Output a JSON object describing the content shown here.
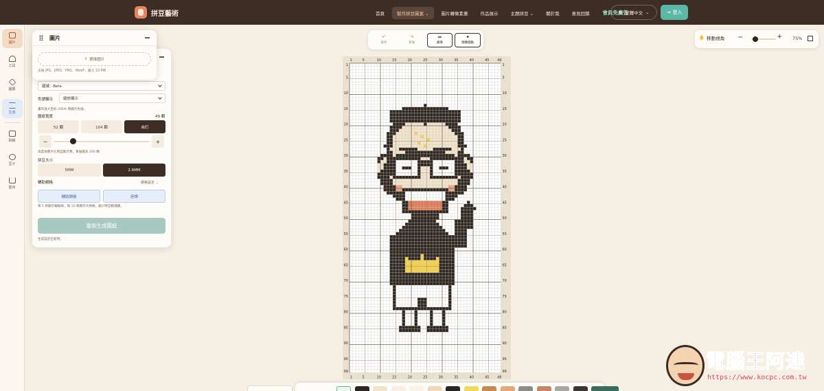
{
  "brand": {
    "name": "拼豆藝術"
  },
  "nav": {
    "items": [
      "首頁",
      "製作拼豆圖案",
      "圖片轉像素畫",
      "作品展示",
      "主題拼豆",
      "關於我",
      "意見回饋"
    ],
    "active_index": 1,
    "vip": "會員免廣告",
    "language": "繁體中文",
    "login": "登入"
  },
  "rail": {
    "items": [
      {
        "label": "圖片",
        "icon": "image-icon"
      },
      {
        "label": "工具",
        "icon": "brush-icon"
      },
      {
        "label": "圖層",
        "icon": "layers-icon"
      },
      {
        "label": "生成",
        "icon": "sliders-icon"
      },
      {
        "label": "對稱",
        "icon": "mirror-icon"
      },
      {
        "label": "豆子",
        "icon": "palette-icon"
      },
      {
        "label": "匯出",
        "icon": "download-icon"
      }
    ]
  },
  "image_panel": {
    "title": "圖片",
    "upload_label": "更換圖片",
    "upload_hint": "支援 JPG、JPEG、PNG、WebP，最大 10 MB"
  },
  "generate_panel": {
    "mode_select": "縮減 · Beta",
    "color_display_label": "色號顯示",
    "color_display_value": "縮放顯示",
    "zoom_hint": "畫布放大至約 200% 時顯示色號。",
    "pattern_width_label": "圖紙寬度",
    "pattern_width_value": "49 顆",
    "presets": [
      "52 顆",
      "104 顆",
      "自訂"
    ],
    "active_preset": 2,
    "stepper_minus": "−",
    "stepper_plus": "+",
    "width_fraction": 0.2,
    "ratio_hint": "高度依圖片比例自動計算，單邊最多 200 顆",
    "bead_size_label": "拼豆大小",
    "bead_sizes": [
      "5MM",
      "2.6MM"
    ],
    "active_bead_size": 1,
    "aux_grid_label": "輔助網格",
    "grid_settings_label": "網格設定",
    "aux_buttons": [
      "輔助網格",
      "座標"
    ],
    "aux_hint": "每 5 格顯示輔助線，每 10 格顯示大格線，縮小時自動隱藏。",
    "regenerate": "重新生成圖紙",
    "status": "生成設定已套用。"
  },
  "toolbar": {
    "buttons": [
      {
        "label": "復原",
        "glyph": "↶",
        "active": false
      },
      {
        "label": "重做",
        "glyph": "↷",
        "active": false
      },
      {
        "label": "鏡像",
        "glyph": "⇹",
        "active": true
      },
      {
        "label": "隨機擺動",
        "glyph": "✦",
        "active": true
      }
    ]
  },
  "zoom": {
    "pan_label": "移動視角",
    "minus": "−",
    "plus": "+",
    "percent": "75%",
    "fraction": 0.1
  },
  "grid": {
    "columns": 49,
    "rows": 99,
    "top_ticks": [
      "1",
      "5",
      "10",
      "15",
      "20",
      "25",
      "30",
      "35",
      "40",
      "45",
      "49"
    ],
    "side_ticks": [
      "1",
      "5",
      "10",
      "15",
      "20",
      "25",
      "30",
      "35",
      "40",
      "45",
      "50",
      "55",
      "60",
      "65",
      "70",
      "75",
      "80",
      "85",
      "90",
      "95",
      "99"
    ],
    "colors": {
      "dark": "#2e2620",
      "skin": "#f2e3cc",
      "white": "#ffffff",
      "blush": "#f0a482",
      "mouth": "#e27c55",
      "gold": "#f4d04a",
      "gray": "#cfc9c0"
    }
  },
  "palette": {
    "colors": [
      "#eef4ea",
      "#2e2620",
      "#f2e3cc",
      "#f8efe2",
      "#fbf2e6",
      "#f3d7b8",
      "#2a2420",
      "#f3d75a",
      "#c98a52",
      "#e7a878",
      "#8e8d8c",
      "#c7866a",
      "#a9a7a5",
      "#3b3633",
      "#3c6b5d"
    ]
  },
  "watermark": {
    "title": "電腦王阿達",
    "url": "https://www.kocpc.com.tw"
  }
}
